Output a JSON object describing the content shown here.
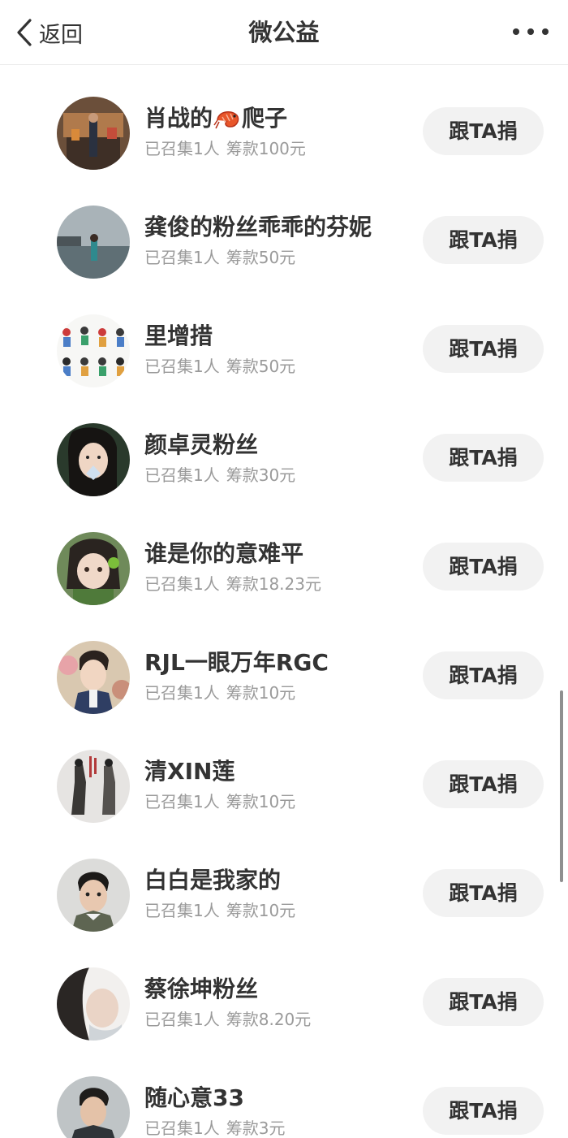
{
  "navbar": {
    "back_label": "返回",
    "title": "微公益"
  },
  "donors": [
    {
      "name_before_icon": "肖战的",
      "name_icon": "shrimp-emoji-icon",
      "name_after_icon": "爬子",
      "collected": "已召集1人",
      "amount": "筹款100元",
      "button": "跟TA捐"
    },
    {
      "name": "龚俊的粉丝乖乖的芬妮",
      "collected": "已召集1人",
      "amount": "筹款50元",
      "button": "跟TA捐"
    },
    {
      "name": "里增措",
      "collected": "已召集1人",
      "amount": "筹款50元",
      "button": "跟TA捐"
    },
    {
      "name": "颜卓灵粉丝",
      "collected": "已召集1人",
      "amount": "筹款30元",
      "button": "跟TA捐"
    },
    {
      "name": "谁是你的意难平",
      "collected": "已召集1人",
      "amount": "筹款18.23元",
      "button": "跟TA捐"
    },
    {
      "name": "RJL一眼万年RGC",
      "collected": "已召集1人",
      "amount": "筹款10元",
      "button": "跟TA捐"
    },
    {
      "name": "清XIN莲",
      "collected": "已召集1人",
      "amount": "筹款10元",
      "button": "跟TA捐"
    },
    {
      "name": "白白是我家的",
      "collected": "已召集1人",
      "amount": "筹款10元",
      "button": "跟TA捐"
    },
    {
      "name": "蔡徐坤粉丝",
      "collected": "已召集1人",
      "amount": "筹款8.20元",
      "button": "跟TA捐"
    },
    {
      "name": "随心意33",
      "collected": "已召集1人",
      "amount": "筹款3元",
      "button": "跟TA捐"
    }
  ],
  "colors": {
    "text_primary": "#333333",
    "text_secondary": "#9a9a9a",
    "button_bg": "#f2f2f2"
  }
}
